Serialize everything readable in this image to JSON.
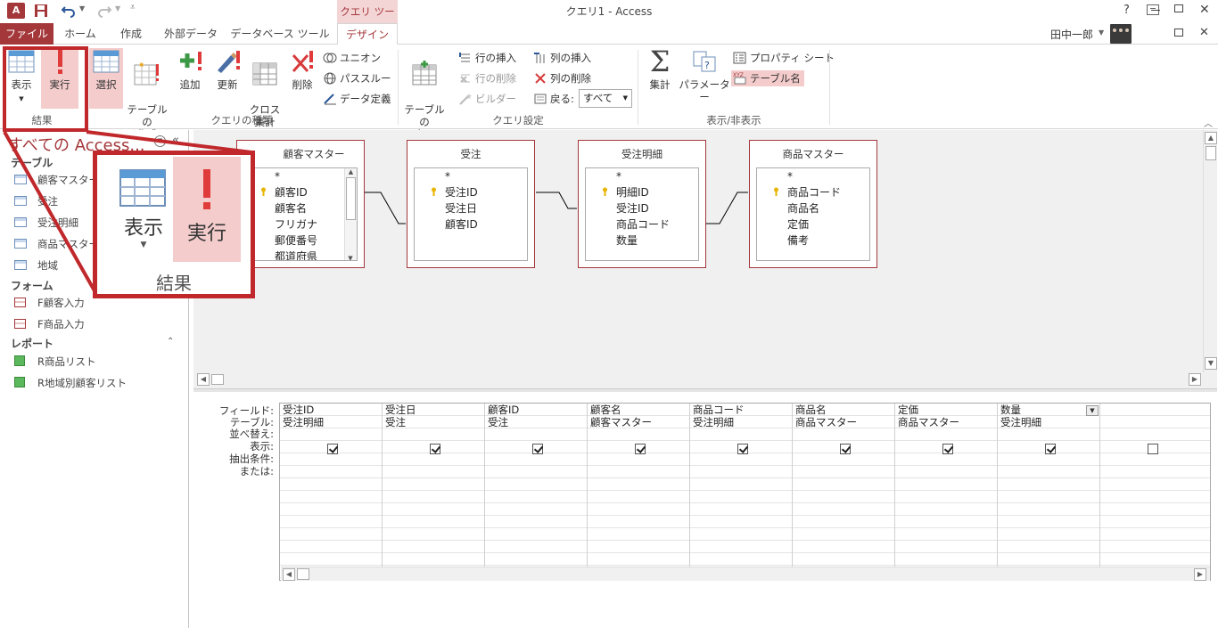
{
  "titlebar": {
    "context_tools": "クエリ ツール",
    "title": "クエリ1 - Access",
    "help": "?",
    "user": "田中一郎"
  },
  "tabs": [
    "ファイル",
    "ホーム",
    "作成",
    "外部データ",
    "データベース ツール",
    "デザイン"
  ],
  "ribbon": {
    "results_group": "結果",
    "view": "表示",
    "run": "実行",
    "select": "選択",
    "make_table": "テーブルの\n作成",
    "append": "追加",
    "update": "更新",
    "crosstab": "クロス\n集計",
    "delete": "削除",
    "union": "ユニオン",
    "passthrough": "パススルー",
    "data_definition": "データ定義",
    "query_type_group": "クエリの種類",
    "show_table": "テーブルの\n表示",
    "insert_rows": "行の挿入",
    "delete_rows": "行の削除",
    "builder": "ビルダー",
    "insert_columns": "列の挿入",
    "delete_columns": "列の削除",
    "return_label": "戻る:",
    "return_value": "すべて",
    "query_setup_group": "クエリ設定",
    "totals": "集計",
    "parameters": "パラメーター",
    "property_sheet": "プロパティ シート",
    "table_names": "テーブル名",
    "show_hide_group": "表示/非表示"
  },
  "callout": {
    "view": "表示",
    "run": "実行",
    "group": "結果"
  },
  "nav": {
    "title": "すべての Access...",
    "sections": [
      {
        "header": "テーブル",
        "items": [
          "顧客マスター",
          "受注",
          "受注明細",
          "商品マスター",
          "地域"
        ]
      },
      {
        "header": "フォーム",
        "items": [
          "F顧客入力",
          "F商品入力"
        ]
      },
      {
        "header": "レポート",
        "items": [
          "R商品リスト",
          "R地域別顧客リスト"
        ]
      }
    ]
  },
  "tables": [
    {
      "name": "顧客マスター",
      "fields": [
        "*",
        "顧客ID",
        "顧客名",
        "フリガナ",
        "郵便番号",
        "都道府県"
      ],
      "keys": [
        1
      ]
    },
    {
      "name": "受注",
      "fields": [
        "*",
        "受注ID",
        "受注日",
        "顧客ID"
      ],
      "keys": [
        1
      ]
    },
    {
      "name": "受注明細",
      "fields": [
        "*",
        "明細ID",
        "受注ID",
        "商品コード",
        "数量"
      ],
      "keys": [
        1
      ]
    },
    {
      "name": "商品マスター",
      "fields": [
        "*",
        "商品コード",
        "商品名",
        "定価",
        "備考"
      ],
      "keys": [
        1
      ]
    }
  ],
  "grid": {
    "row_labels": [
      "フィールド:",
      "テーブル:",
      "並べ替え:",
      "表示:",
      "抽出条件:",
      "または:"
    ],
    "columns": [
      {
        "field": "受注ID",
        "table": "受注明細",
        "show": true
      },
      {
        "field": "受注日",
        "table": "受注",
        "show": true
      },
      {
        "field": "顧客ID",
        "table": "受注",
        "show": true
      },
      {
        "field": "顧客名",
        "table": "顧客マスター",
        "show": true
      },
      {
        "field": "商品コード",
        "table": "受注明細",
        "show": true
      },
      {
        "field": "商品名",
        "table": "商品マスター",
        "show": true
      },
      {
        "field": "定価",
        "table": "商品マスター",
        "show": true
      },
      {
        "field": "数量",
        "table": "受注明細",
        "show": true
      },
      {
        "field": "",
        "table": "",
        "show": false
      }
    ]
  },
  "colors": {
    "file_tab": "#a4373a",
    "accent": "#a4373a",
    "highlight": "#f4cccc",
    "callout_border": "#c0282b"
  }
}
